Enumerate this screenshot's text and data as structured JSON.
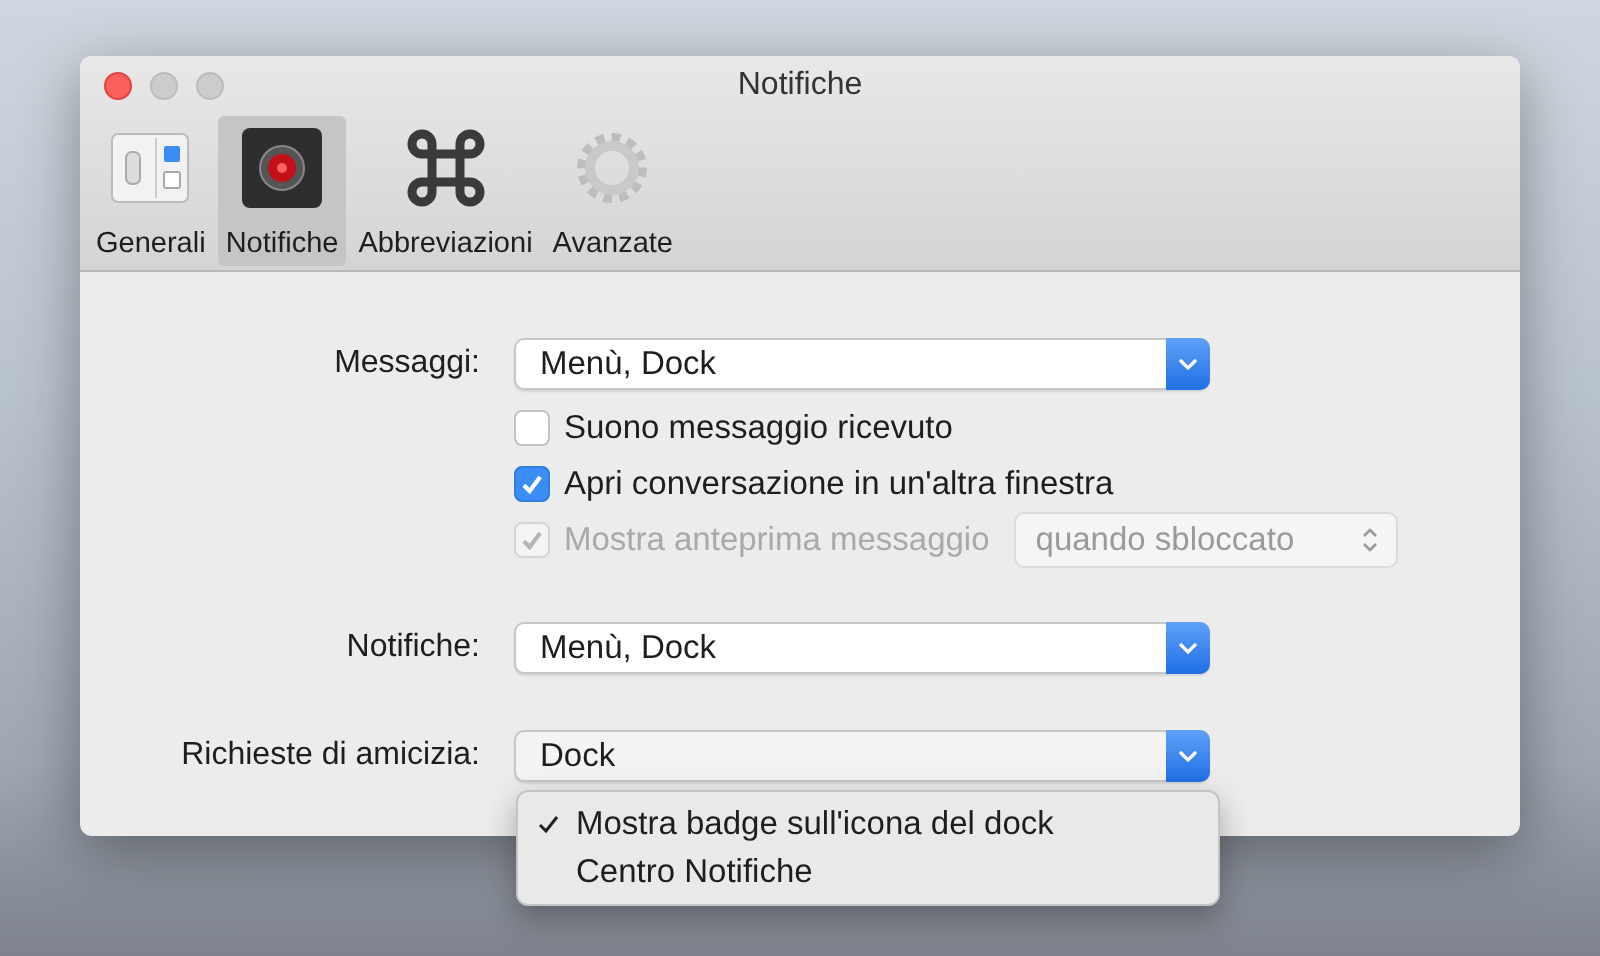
{
  "window": {
    "title": "Notifiche"
  },
  "toolbar": [
    {
      "label": "Generali",
      "kind": "general",
      "selected": false
    },
    {
      "label": "Notifiche",
      "kind": "notifications",
      "selected": true
    },
    {
      "label": "Abbreviazioni",
      "kind": "shortcuts",
      "selected": false
    },
    {
      "label": "Avanzate",
      "kind": "advanced",
      "selected": false
    }
  ],
  "messages": {
    "label": "Messaggi:",
    "value": "Menù, Dock",
    "options": [
      {
        "label": "Suono messaggio ricevuto",
        "checked": false,
        "disabled": false
      },
      {
        "label": "Apri conversazione in un'altra finestra",
        "checked": true,
        "disabled": false
      },
      {
        "label": "Mostra anteprima messaggio",
        "checked": true,
        "disabled": true,
        "popup": "quando sbloccato"
      }
    ]
  },
  "notifications": {
    "label": "Notifiche:",
    "value": "Menù, Dock"
  },
  "friend_requests": {
    "label": "Richieste di amicizia:",
    "value": "Dock",
    "menu": [
      {
        "label": "Mostra badge sull'icona del dock",
        "selected": true
      },
      {
        "label": "Centro Notifiche",
        "selected": false
      }
    ]
  }
}
